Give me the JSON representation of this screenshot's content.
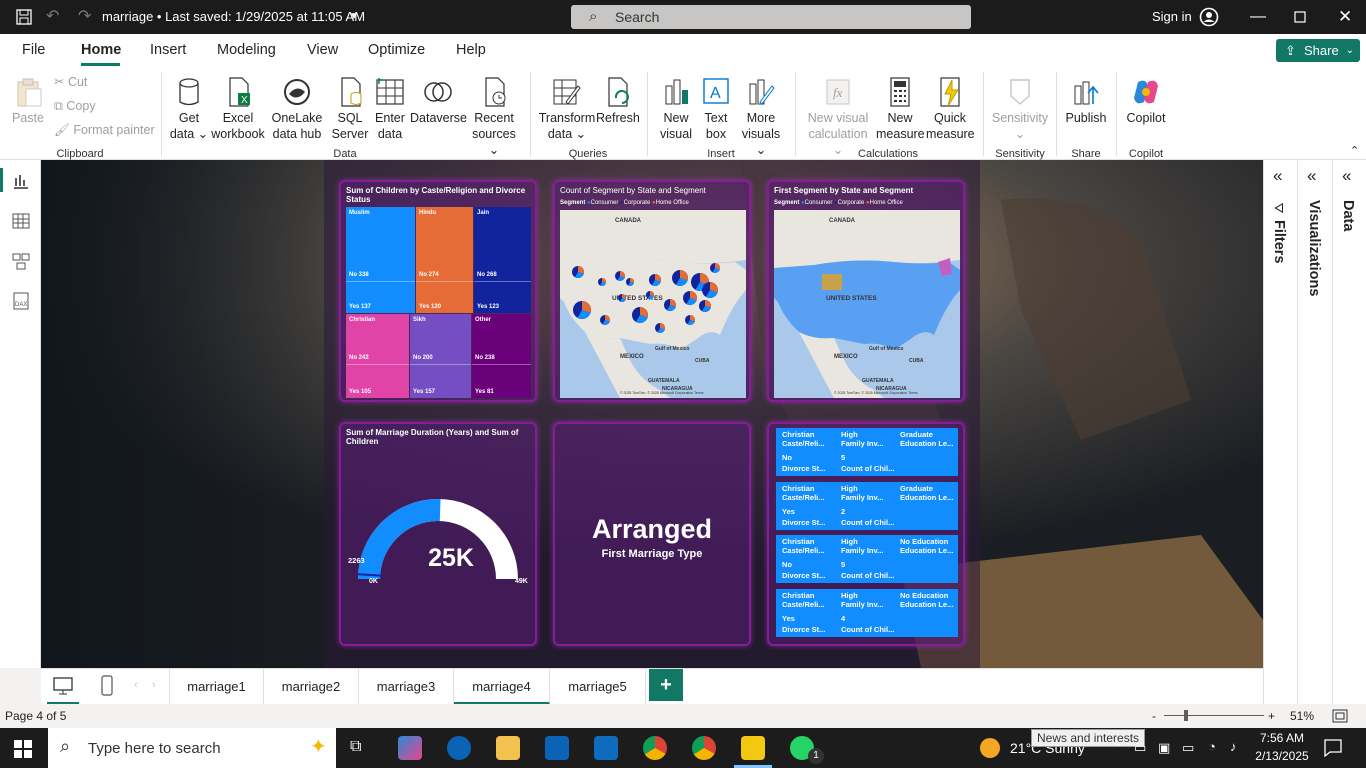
{
  "titlebar": {
    "file_title": "marriage • Last saved: 1/29/2025 at 11:05 AM",
    "search_placeholder": "Search",
    "sign_in": "Sign in"
  },
  "menu": {
    "items": [
      "File",
      "Home",
      "Insert",
      "Modeling",
      "View",
      "Optimize",
      "Help"
    ],
    "share": "Share"
  },
  "ribbon": {
    "clipboard": {
      "paste": "Paste",
      "cut": "Cut",
      "copy": "Copy",
      "format_painter": "Format painter",
      "group": "Clipboard"
    },
    "data": {
      "get_data": "Get data",
      "excel": "Excel workbook",
      "onelake": "OneLake data hub",
      "sql": "SQL Server",
      "enter": "Enter data",
      "dataverse": "Dataverse",
      "recent": "Recent sources",
      "group": "Data"
    },
    "queries": {
      "transform": "Transform data",
      "refresh": "Refresh",
      "group": "Queries"
    },
    "insert": {
      "new_visual": "New visual",
      "text_box": "Text box",
      "more_visuals": "More visuals",
      "group": "Insert"
    },
    "calculations": {
      "new_visual_calc": "New visual calculation",
      "new_measure": "New measure",
      "quick_measure": "Quick measure",
      "group": "Calculations"
    },
    "sensitivity": {
      "label": "Sensitivity",
      "group": "Sensitivity"
    },
    "share": {
      "publish": "Publish",
      "group": "Share"
    },
    "copilot": {
      "label": "Copilot",
      "group": "Copilot"
    }
  },
  "panes": {
    "filters": "Filters",
    "visualizations": "Visualizations",
    "data": "Data"
  },
  "visuals": {
    "treemap": {
      "title": "Sum of Children by Caste/Religion and Divorce Status",
      "tiles": [
        {
          "name": "Muslim",
          "no": "No 338",
          "yes": "Yes 137",
          "color": "#118dff"
        },
        {
          "name": "Hindu",
          "no": "No 274",
          "yes": "Yes 120",
          "color": "#e66c37"
        },
        {
          "name": "Jain",
          "no": "No 268",
          "yes": "Yes 123",
          "color": "#12239e"
        },
        {
          "name": "Christian",
          "no": "No 242",
          "yes": "Yes 105",
          "color": "#e044a7"
        },
        {
          "name": "Sikh",
          "no": "No 200",
          "yes": "Yes 157",
          "color": "#744ec2"
        },
        {
          "name": "Other",
          "no": "No 238",
          "yes": "Yes 81",
          "color": "#6b007b"
        }
      ]
    },
    "map1": {
      "title": "Count of Segment by State and Segment",
      "legend": [
        "Segment",
        "Consumer",
        "Corporate",
        "Home Office"
      ],
      "labels": {
        "canada": "CANADA",
        "us": "UNITED STATES",
        "mexico": "MEXICO",
        "gulf": "Gulf of Mexico",
        "cuba": "CUBA",
        "guatemala": "GUATEMALA",
        "nicaragua": "NICARAGUA"
      },
      "credit": "© 2025 TomTom, © 2025 Microsoft Corporation Terms"
    },
    "map2": {
      "title": "First Segment by State and Segment",
      "legend": [
        "Segment",
        "Consumer",
        "Corporate",
        "Home Office"
      ],
      "labels": {
        "canada": "CANADA",
        "us": "UNITED STATES",
        "mexico": "MEXICO",
        "gulf": "Gulf of Mexico",
        "cuba": "CUBA",
        "guatemala": "GUATEMALA",
        "nicaragua": "NICARAGUA"
      },
      "credit": "© 2025 TomTom, © 2025 Microsoft Corporation Terms"
    },
    "gauge": {
      "title": "Sum of Marriage Duration (Years) and Sum of Children",
      "value": "25K",
      "target": "2263",
      "min": "0K",
      "max": "49K",
      "fill_fraction": 0.51
    },
    "card": {
      "value": "Arranged",
      "label": "First Marriage Type"
    },
    "multirow": {
      "rows": [
        {
          "a": "Christian",
          "b": "High",
          "c": "Graduate",
          "d": "Caste/Reli...",
          "e": "Family Inv...",
          "f": "Education Le...",
          "g": "No",
          "h": "5",
          "i": "Divorce St...",
          "j": "Count of Chil..."
        },
        {
          "a": "Christian",
          "b": "High",
          "c": "Graduate",
          "d": "Caste/Reli...",
          "e": "Family Inv...",
          "f": "Education Le...",
          "g": "Yes",
          "h": "2",
          "i": "Divorce St...",
          "j": "Count of Chil..."
        },
        {
          "a": "Christian",
          "b": "High",
          "c": "No Education",
          "d": "Caste/Reli...",
          "e": "Family Inv...",
          "f": "Education Le...",
          "g": "No",
          "h": "5",
          "i": "Divorce St...",
          "j": "Count of Chil..."
        },
        {
          "a": "Christian",
          "b": "High",
          "c": "No Education",
          "d": "Caste/Reli...",
          "e": "Family Inv...",
          "f": "Education Le...",
          "g": "Yes",
          "h": "4",
          "i": "Divorce St...",
          "j": "Count of Chil..."
        }
      ]
    }
  },
  "pages": {
    "tabs": [
      "marriage1",
      "marriage2",
      "marriage3",
      "marriage4",
      "marriage5"
    ],
    "selected": "marriage4",
    "indicator": "Page 4 of 5",
    "zoom": "51%"
  },
  "taskbar": {
    "search_placeholder": "Type here to search",
    "weather": "21°C  Sunny",
    "tooltip": "News and interests",
    "time": "7:56 AM",
    "date": "2/13/2025",
    "whatsapp_badge": "1"
  },
  "colors": {
    "accent": "#117865",
    "consumer": "#118dff",
    "corporate": "#12239e",
    "home_office": "#e66c37",
    "card_border": "#8b1a9b"
  }
}
